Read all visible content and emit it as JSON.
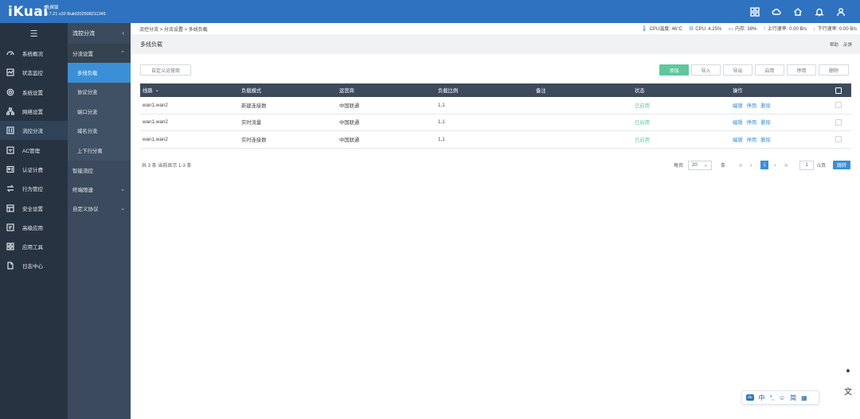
{
  "header": {
    "logo": "iKuai",
    "edition": "免费版",
    "version": "3.7.21 x32 Build202508211345",
    "icons": [
      "grid-icon",
      "cloud-icon",
      "home-icon",
      "bell-icon",
      "user-icon"
    ]
  },
  "sidebar": {
    "collapse_icon": "menu-collapse-icon",
    "items": [
      {
        "label": "系统概况",
        "icon": "gauge-icon"
      },
      {
        "label": "状态监控",
        "icon": "monitor-icon"
      },
      {
        "label": "系统设置",
        "icon": "gear-icon"
      },
      {
        "label": "网络设置",
        "icon": "network-icon"
      },
      {
        "label": "流控分流",
        "icon": "sliders-icon"
      },
      {
        "label": "AC管理",
        "icon": "wifi-icon"
      },
      {
        "label": "认证计费",
        "icon": "id-card-icon"
      },
      {
        "label": "行为管控",
        "icon": "arrows-icon"
      },
      {
        "label": "安全设置",
        "icon": "shield-icon"
      },
      {
        "label": "高级应用",
        "icon": "app-icon"
      },
      {
        "label": "应用工具",
        "icon": "tools-icon"
      },
      {
        "label": "日志中心",
        "icon": "log-icon"
      }
    ],
    "active_index": 4
  },
  "submenu": {
    "title": "流控分流",
    "group1": "分流设置",
    "subs": [
      "多线负载",
      "协议分流",
      "端口分流",
      "域名分流",
      "上下行分离"
    ],
    "active_sub": 0,
    "group2": "智能流控",
    "group3": "终端限速",
    "group4": "自定义协议"
  },
  "breadcrumb": "流控分流 > 分流设置 > 多线负载",
  "status": {
    "cpu_temp": "CPU温度: 46°C",
    "cpu": "CPU: 4.25%",
    "memory": "内存: 38%",
    "upload": "上行速率: 0.00 B/s",
    "download": "下行速率: 0.00 B/s"
  },
  "page": {
    "title": "多线负载",
    "help": "帮助",
    "feedback": "反馈"
  },
  "toolbar": {
    "custom_isp": "自定义运营商",
    "add": "添加",
    "import": "导入",
    "export": "导出",
    "enable": "启用",
    "disable": "停用",
    "delete": "删除"
  },
  "table": {
    "headers": [
      "线路",
      "负载模式",
      "运营商",
      "负载比例",
      "备注",
      "状态",
      "操作"
    ],
    "rows": [
      {
        "line": "wan1,wan2",
        "mode": "新建连接数",
        "isp": "中国联通",
        "ratio": "1,1",
        "remark": "",
        "status": "已启用"
      },
      {
        "line": "wan1,wan2",
        "mode": "实时流量",
        "isp": "中国联通",
        "ratio": "1,1",
        "remark": "",
        "status": "已启用"
      },
      {
        "line": "wan1,wan2",
        "mode": "实时连接数",
        "isp": "中国联通",
        "ratio": "1,1",
        "remark": "",
        "status": "已启用"
      }
    ],
    "ops": [
      "编辑",
      "停用",
      "删除"
    ]
  },
  "pager": {
    "summary": "共 3 条 当前显示 1-3 条",
    "per_page_label": "每页",
    "per_page": "20",
    "unit": "条",
    "current": "1",
    "goto_value": "1",
    "total_pages": "/1页",
    "jump": "跳转"
  },
  "ime": {
    "du": "du",
    "zh": "中",
    "dot": "°,",
    "simp": "简"
  }
}
